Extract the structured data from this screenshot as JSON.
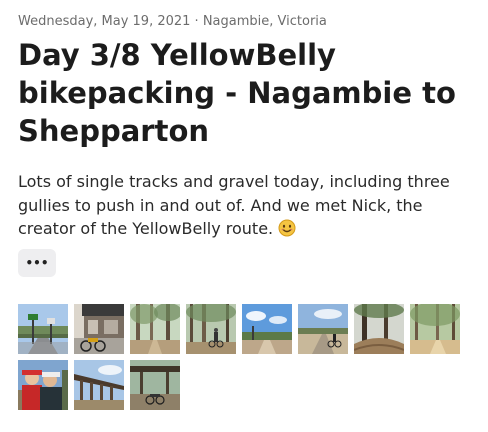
{
  "post": {
    "meta": "Wednesday, May 19, 2021 · Nagambie, Victoria",
    "title": "Day 3/8 YellowBelly bikepacking - Nagambie to Shepparton",
    "description": "Lots of single tracks and gravel today, including three gullies to push in and out of. And we met Nick, the creator of the YellowBelly route.",
    "emoji_icon": "smiling-face-icon",
    "more_label": "•••"
  },
  "photos": [
    {
      "subject": "road with traffic signs and pole"
    },
    {
      "subject": "shopfront with bicycles"
    },
    {
      "subject": "forest track with tall trees"
    },
    {
      "subject": "rider among trees on gravel"
    },
    {
      "subject": "gravel trail under blue sky"
    },
    {
      "subject": "cyclist on open road"
    },
    {
      "subject": "gully with trees"
    },
    {
      "subject": "sunny forest trail"
    },
    {
      "subject": "selfie of riders"
    },
    {
      "subject": "old wooden rail bridge"
    },
    {
      "subject": "bikes under bridge shade"
    }
  ],
  "colors": {
    "text": "#1c1c1c",
    "meta": "#6c6c6c",
    "button_bg": "#eeeef0",
    "emoji": "#f5c542"
  }
}
